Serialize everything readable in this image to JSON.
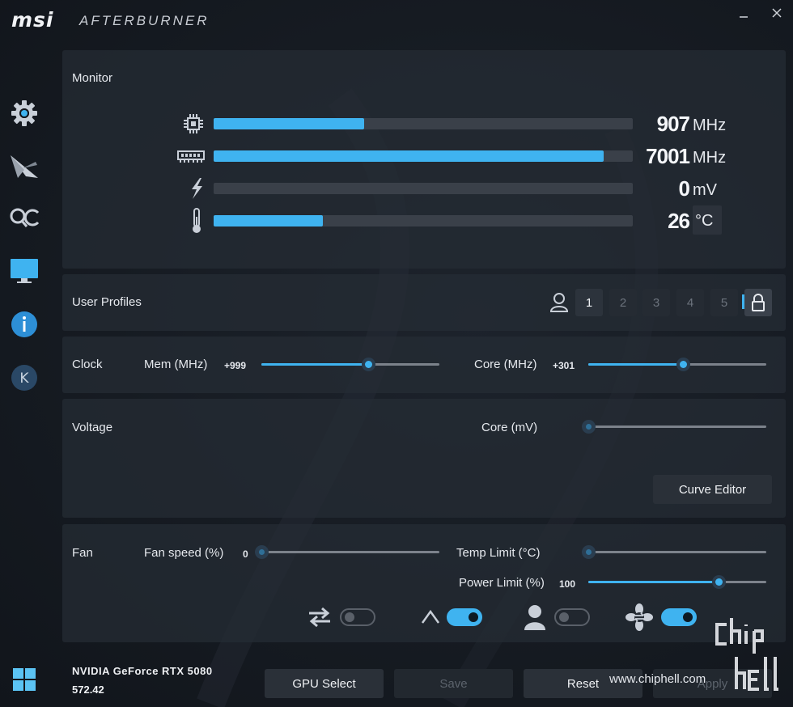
{
  "titlebar": {
    "logo": "msi",
    "app_name": "AFTERBURNER",
    "minimize_icon": "minimize-icon",
    "close_icon": "close-icon"
  },
  "sidebar": {
    "items": [
      {
        "name": "settings",
        "icon": "gear-icon"
      },
      {
        "name": "oc-scanner",
        "icon": "afterburner-plane-icon"
      },
      {
        "name": "oc-scan",
        "icon": "oc-search-icon"
      },
      {
        "name": "monitor",
        "icon": "display-icon"
      },
      {
        "name": "info",
        "icon": "info-icon"
      },
      {
        "name": "kombustor",
        "icon": "k-icon"
      }
    ],
    "bottom_icon": "windows-icon"
  },
  "monitor": {
    "title": "Monitor",
    "rows": [
      {
        "icon": "cpu-chip-icon",
        "value": "907",
        "unit": "MHz",
        "fill_pct": 36
      },
      {
        "icon": "memory-icon",
        "value": "7001",
        "unit": "MHz",
        "fill_pct": 93
      },
      {
        "icon": "voltage-bolt-icon",
        "value": "0",
        "unit": "mV",
        "fill_pct": 0
      },
      {
        "icon": "thermometer-icon",
        "value": "26",
        "unit": "°C",
        "fill_pct": 26
      }
    ]
  },
  "profiles": {
    "title": "User Profiles",
    "slots": [
      "1",
      "2",
      "3",
      "4",
      "5"
    ],
    "active": "1"
  },
  "clock": {
    "title": "Clock",
    "mem_label": "Mem (MHz)",
    "mem_value": "+999",
    "mem_pct": 60,
    "core_label": "Core (MHz)",
    "core_value": "+301",
    "core_pct": 53
  },
  "voltage": {
    "title": "Voltage",
    "core_label": "Core (mV)",
    "core_pct": 0,
    "curve_editor": "Curve Editor"
  },
  "fan": {
    "title": "Fan",
    "fan_speed_label": "Fan speed (%)",
    "fan_speed_value": "0",
    "fan_speed_pct": 0,
    "temp_limit_label": "Temp Limit (°C)",
    "temp_limit_pct": 0,
    "power_limit_label": "Power Limit (%)",
    "power_limit_value": "100",
    "power_limit_pct": 73,
    "toggles": [
      {
        "icon": "sync-arrows-icon",
        "on": false
      },
      {
        "icon": "auto-icon",
        "on": true
      },
      {
        "icon": "user-icon",
        "on": false
      },
      {
        "icon": "fan-sync-icon",
        "on": true
      }
    ]
  },
  "footer": {
    "gpu_name": "NVIDIA GeForce RTX 5080",
    "driver": "572.42",
    "gpu_select": "GPU Select",
    "save": "Save",
    "reset": "Reset",
    "apply": "Apply"
  },
  "watermark": {
    "site": "www.chiphell.com",
    "logo": "chip hell"
  },
  "colors": {
    "accent": "#3fb3f0",
    "panel": "#262c35",
    "background": "#161b22"
  }
}
